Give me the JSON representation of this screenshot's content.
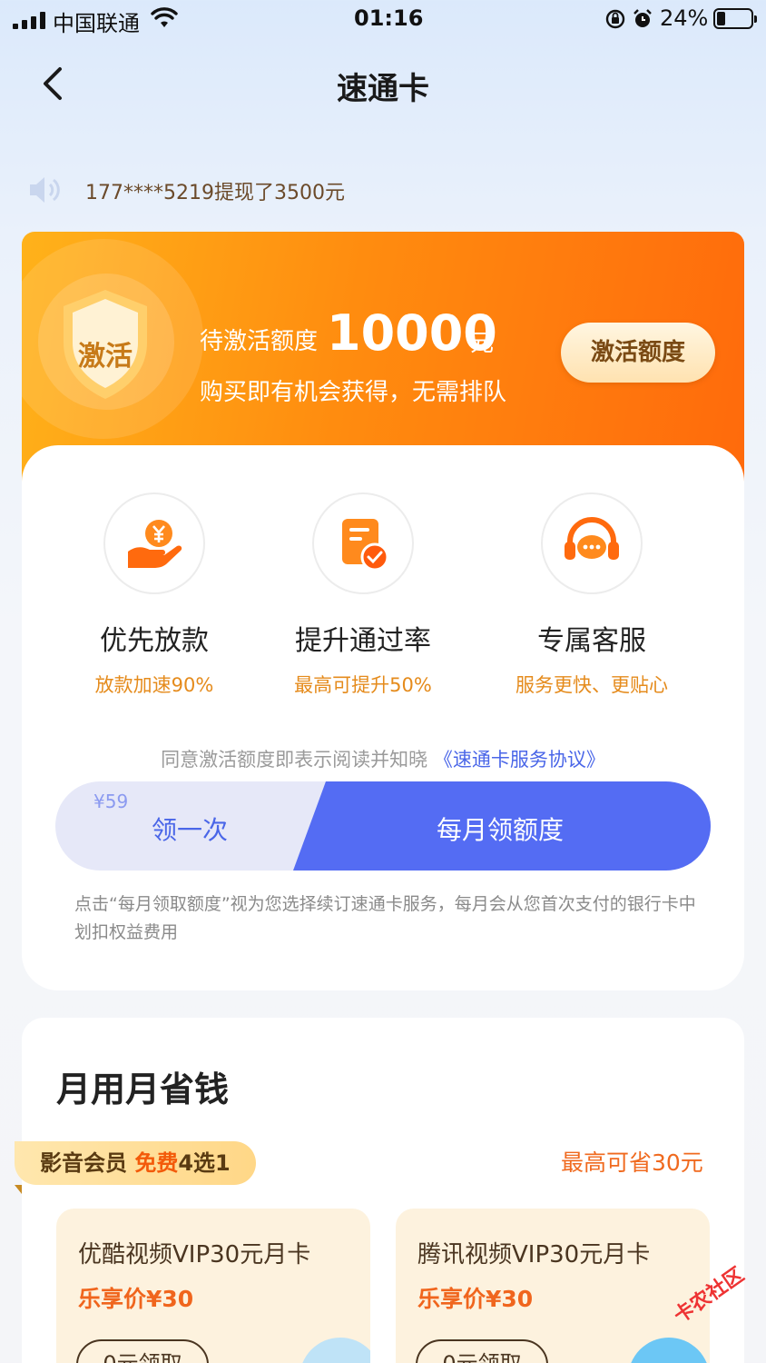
{
  "status_bar": {
    "carrier": "中国联通",
    "time": "01:16",
    "battery": "24%"
  },
  "nav": {
    "title": "速通卡"
  },
  "notice": {
    "text": "177****5219提现了3500元"
  },
  "banner": {
    "badge": "激活",
    "quota_label": "待激活额度",
    "quota_amount": "10000",
    "quota_unit": "元",
    "subtitle": "购买即有机会获得，无需排队",
    "button": "激活额度"
  },
  "features": [
    {
      "title": "优先放款",
      "sub": "放款加速90%",
      "icon": "yuan-hand-icon"
    },
    {
      "title": "提升通过率",
      "sub": "最高可提升50%",
      "icon": "document-check-icon"
    },
    {
      "title": "专属客服",
      "sub": "服务更快、更贴心",
      "icon": "headset-icon"
    }
  ],
  "agreement": {
    "prefix": "同意激活额度即表示阅读并知晓",
    "link": "《速通卡服务协议》"
  },
  "options": {
    "once_price": "¥59",
    "once_label": "领一次",
    "monthly_label": "每月领额度"
  },
  "fine_print": "点击“每月领取额度”视为您选择续订速通卡服务，每月会从您首次支付的银行卡中划扣权益费用",
  "section": {
    "title": "月用月省钱",
    "tag_prefix": "影音会员 ",
    "tag_highlight": "免费",
    "tag_suffix": "4选1",
    "save_note": "最高可省30元",
    "items": [
      {
        "name": "优酷视频VIP30元月卡",
        "price": "乐享价¥30",
        "button": "0元领取"
      },
      {
        "name": "腾讯视频VIP30元月卡",
        "price": "乐享价¥30",
        "button": "0元领取"
      }
    ]
  },
  "watermark": "卡农社区"
}
